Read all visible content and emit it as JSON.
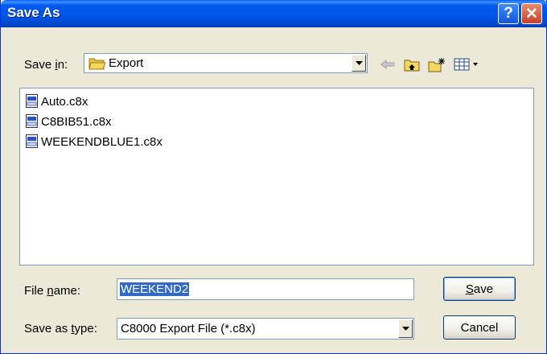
{
  "window": {
    "title": "Save As"
  },
  "title_buttons": {
    "help": "?",
    "close": "✕"
  },
  "save_in": {
    "label_pre": "Save ",
    "label_key": "i",
    "label_post": "n:",
    "value": "Export"
  },
  "files": [
    {
      "name": "Auto.c8x"
    },
    {
      "name": "C8BIB51.c8x"
    },
    {
      "name": "WEEKENDBLUE1.c8x"
    }
  ],
  "file_name": {
    "label_pre": "File ",
    "label_key": "n",
    "label_post": "ame:",
    "value": "WEEKEND2"
  },
  "save_as_type": {
    "label_pre": "Save as ",
    "label_key": "t",
    "label_post": "ype:",
    "value": "C8000 Export File (*.c8x)"
  },
  "buttons": {
    "save": {
      "key": "S",
      "rest": "ave"
    },
    "cancel": "Cancel"
  },
  "colors": {
    "titlebar": "#0055e5",
    "selection": "#316ac5",
    "close": "#c8402a",
    "folder": "#f5d75e"
  }
}
